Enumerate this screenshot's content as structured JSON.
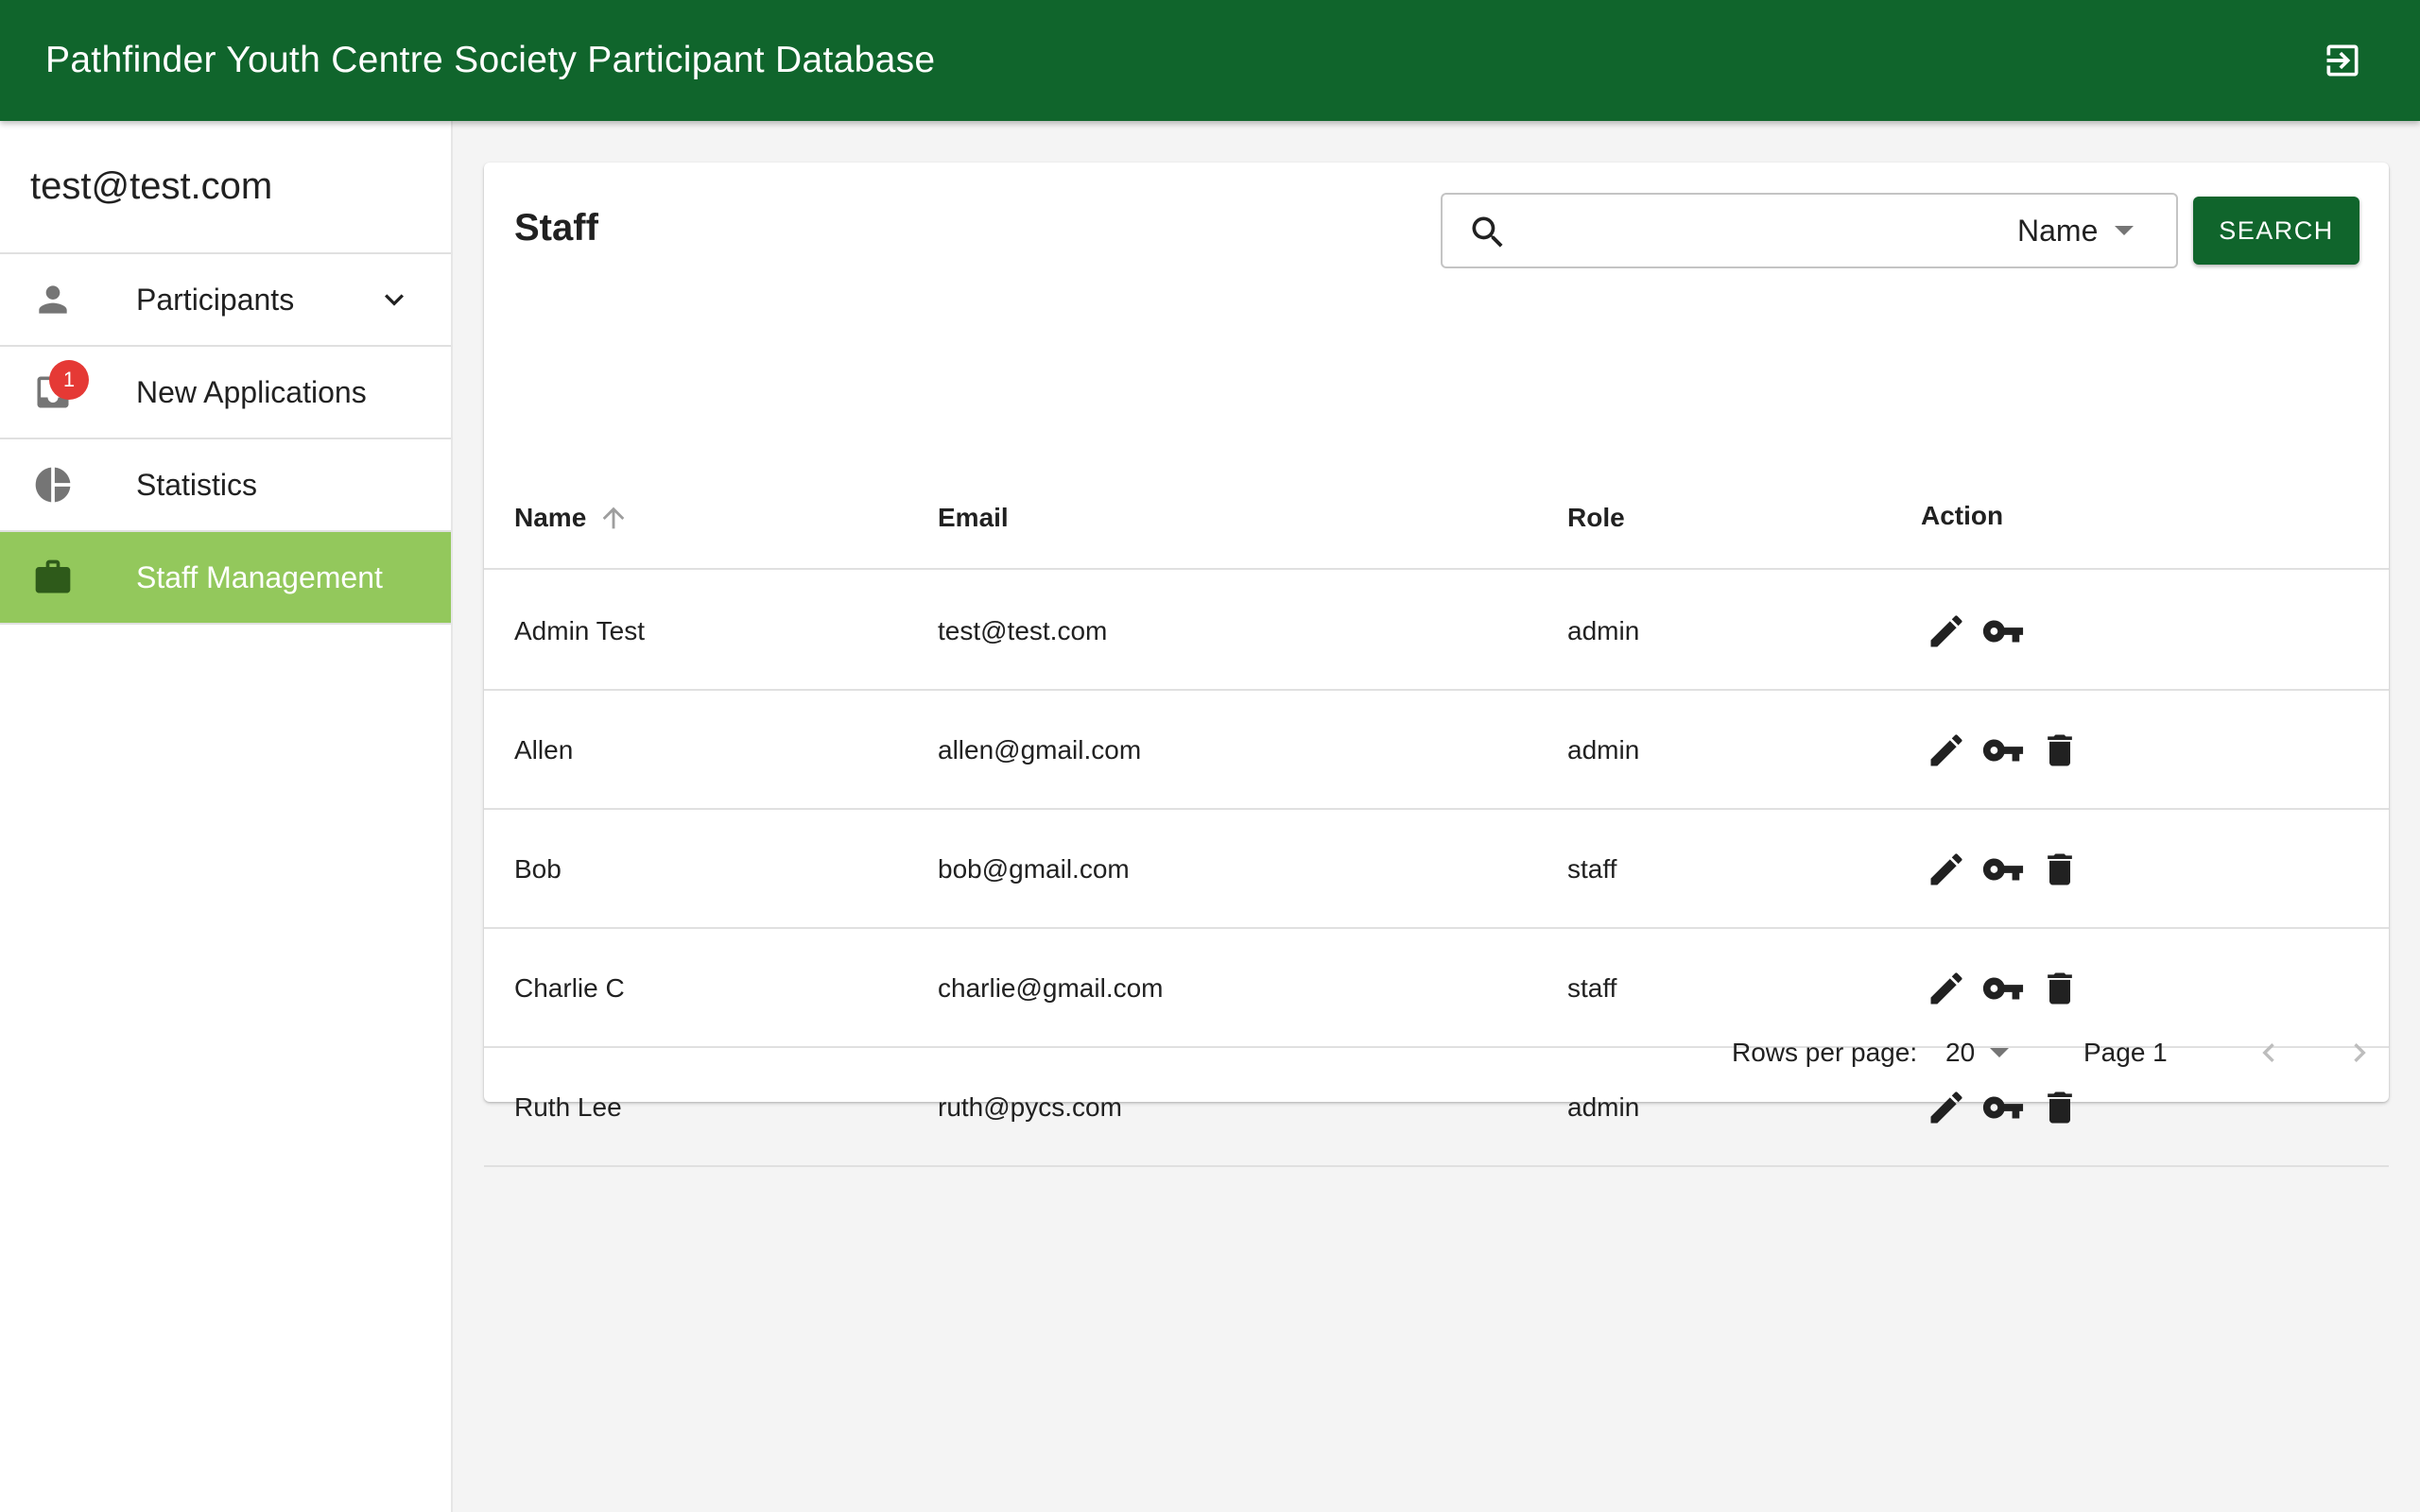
{
  "header": {
    "title": "Pathfinder Youth Centre Society Participant Database",
    "logout_icon": "logout-icon",
    "background_color": "#10652c"
  },
  "sidebar": {
    "user_email": "test@test.com",
    "items": [
      {
        "label": "Participants",
        "icon": "person-icon",
        "expandable": true
      },
      {
        "label": "New Applications",
        "icon": "inbox-icon",
        "badge": "1"
      },
      {
        "label": "Statistics",
        "icon": "pie-chart-icon"
      },
      {
        "label": "Staff Management",
        "icon": "briefcase-icon",
        "active": true
      }
    ],
    "active_color": "#93c85c"
  },
  "main": {
    "title": "Staff",
    "search": {
      "placeholder": "",
      "field": "Name",
      "button_label": "SEARCH"
    },
    "table": {
      "columns": [
        "Name",
        "Email",
        "Role",
        "Action"
      ],
      "sort_column": "Name",
      "sort_direction": "ascending",
      "rows": [
        {
          "name": "Admin Test",
          "email": "test@test.com",
          "role": "admin",
          "actions": [
            "edit",
            "key"
          ]
        },
        {
          "name": "Allen",
          "email": "allen@gmail.com",
          "role": "admin",
          "actions": [
            "edit",
            "key",
            "delete"
          ]
        },
        {
          "name": "Bob",
          "email": "bob@gmail.com",
          "role": "staff",
          "actions": [
            "edit",
            "key",
            "delete"
          ]
        },
        {
          "name": "Charlie C",
          "email": "charlie@gmail.com",
          "role": "staff",
          "actions": [
            "edit",
            "key",
            "delete"
          ]
        },
        {
          "name": "Ruth Lee",
          "email": "ruth@pycs.com",
          "role": "admin",
          "actions": [
            "edit",
            "key",
            "delete"
          ]
        }
      ]
    },
    "pagination": {
      "rows_per_page_label": "Rows per page:",
      "rows_per_page": "20",
      "page_label": "Page 1"
    }
  }
}
